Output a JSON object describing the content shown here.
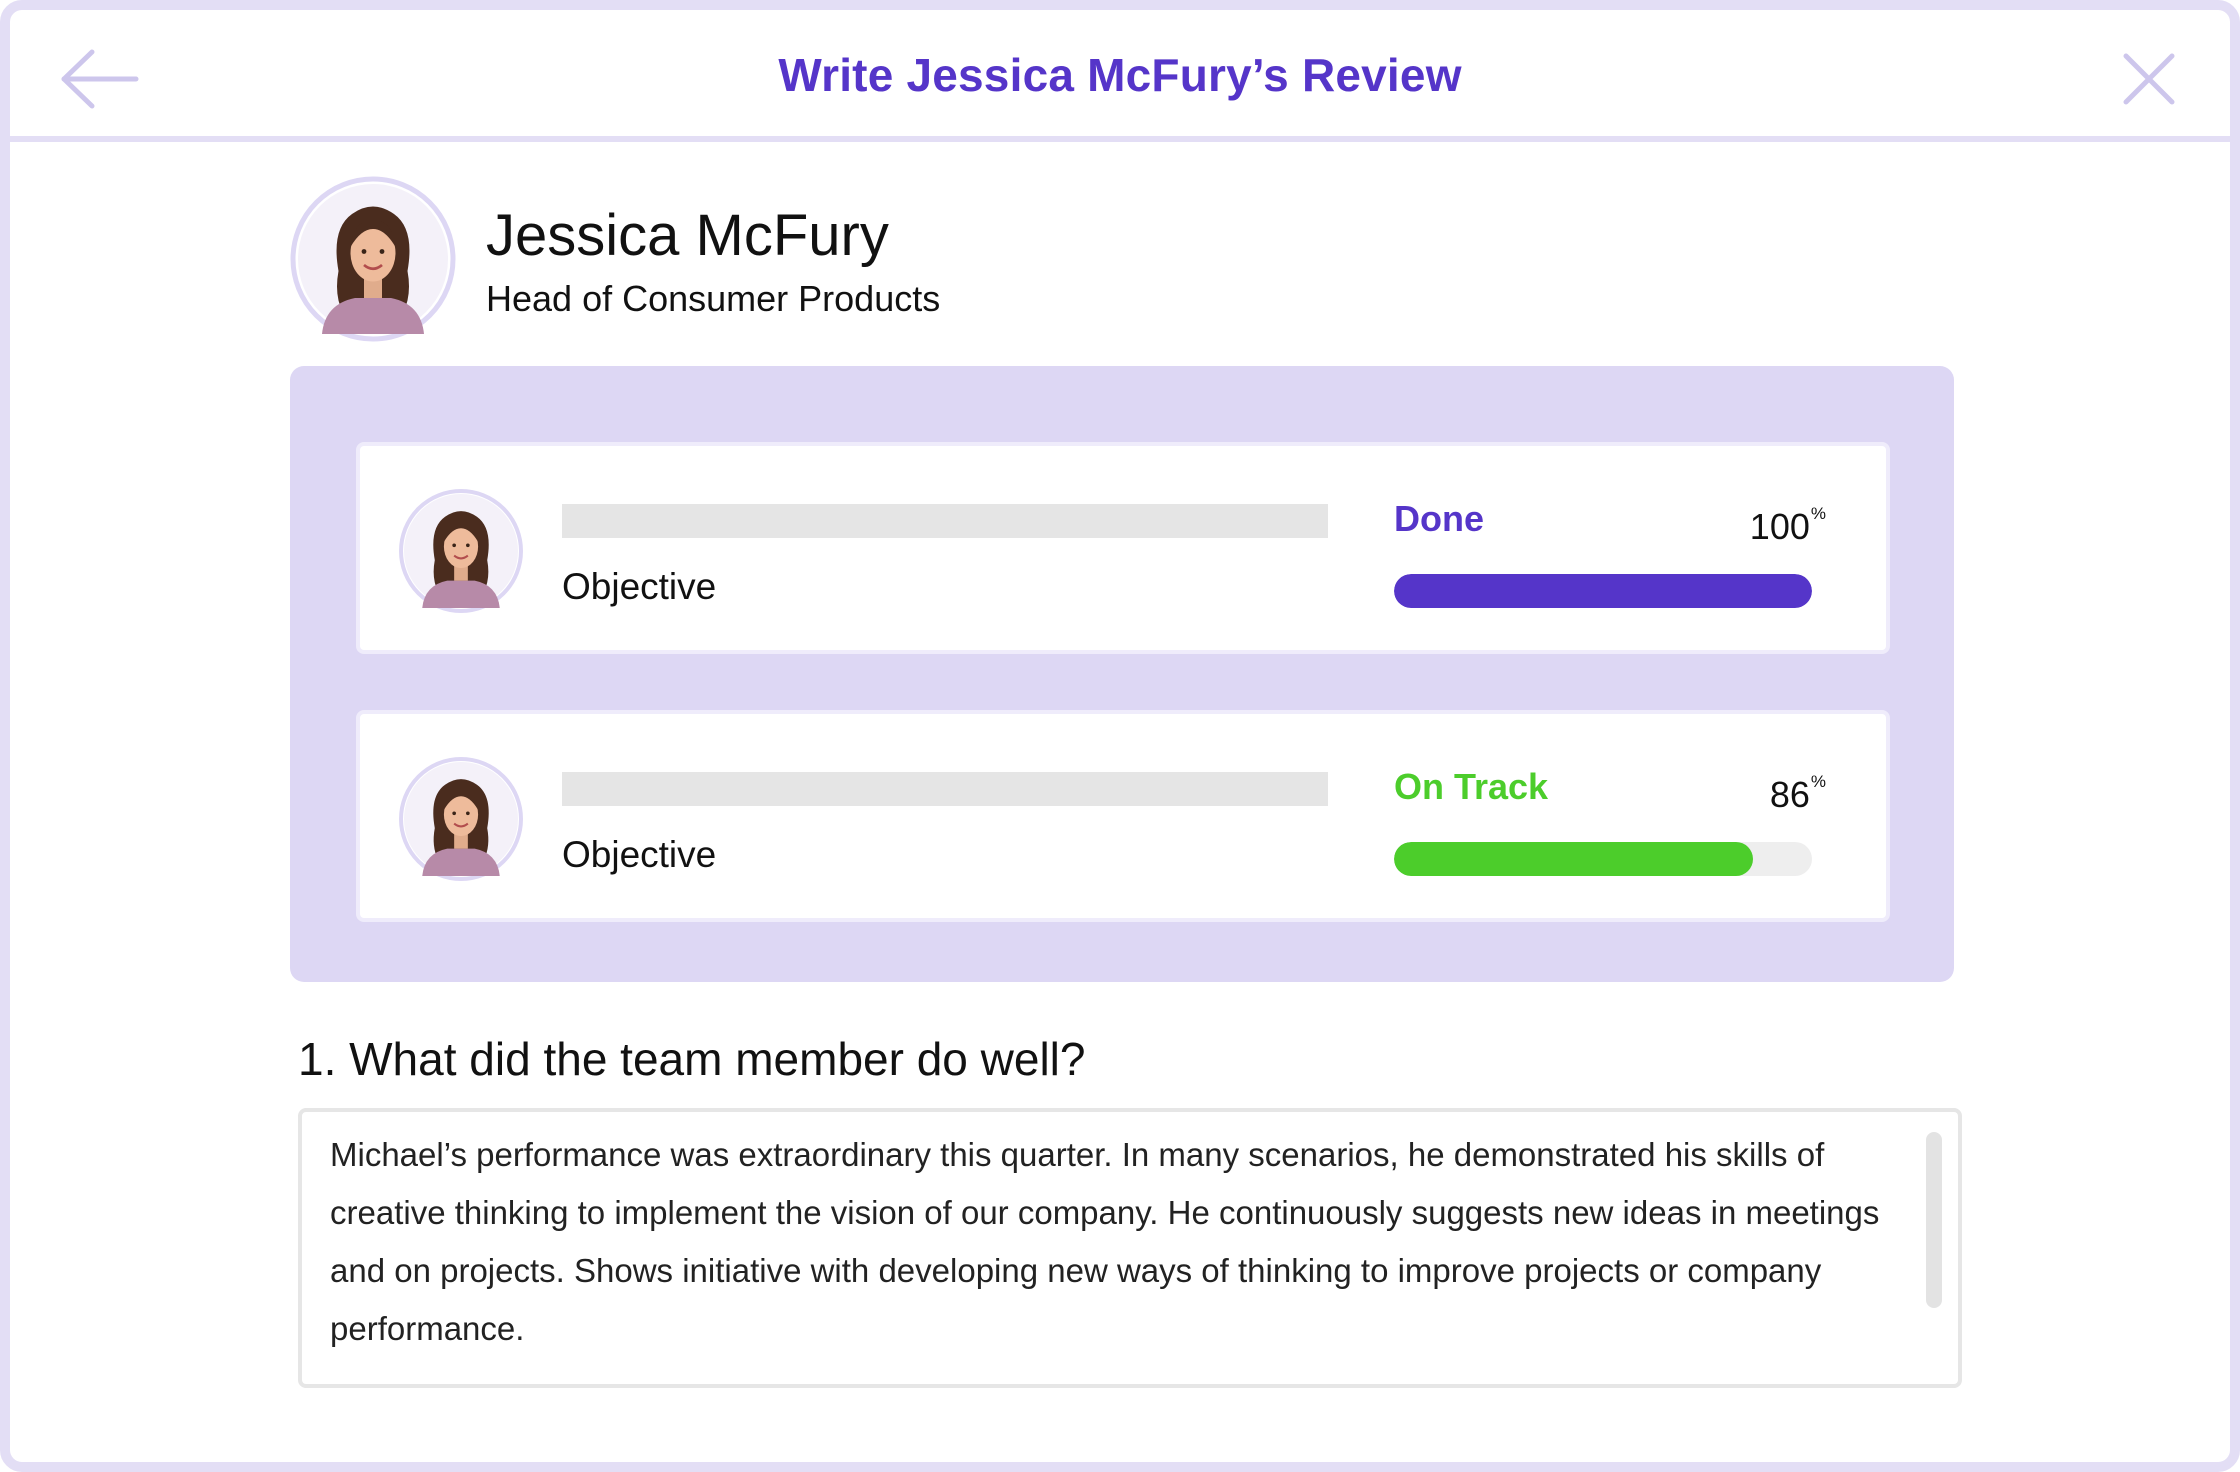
{
  "header": {
    "title": "Write Jessica McFury’s Review",
    "back_icon": "arrow-left-icon",
    "close_icon": "close-icon"
  },
  "profile": {
    "name": "Jessica McFury",
    "role": "Head of Consumer Products"
  },
  "objectives": [
    {
      "label": "Objective",
      "status": "Done",
      "status_color": "#5535c9",
      "percent_value": "100",
      "percent_sign": "%",
      "progress": 1.0,
      "bar_color": "#5535c9"
    },
    {
      "label": "Objective",
      "status": "On Track",
      "status_color": "#4ccd2b",
      "percent_value": "86",
      "percent_sign": "%",
      "progress": 0.86,
      "bar_color": "#4ccd2b"
    }
  ],
  "question": {
    "text": "1. What did the team member do well?",
    "answer": "Michael’s performance was extraordinary this quarter. In many scenarios, he demonstrated his skills of creative thinking to implement the vision of our company. He continuously suggests new ideas in meetings and on projects. Shows initiative with developing new ways of thinking to improve projects or company performance."
  },
  "colors": {
    "accent": "#5535c9",
    "success": "#4ccd2b",
    "panel": "#ddd7f4",
    "border": "#e3def5"
  }
}
